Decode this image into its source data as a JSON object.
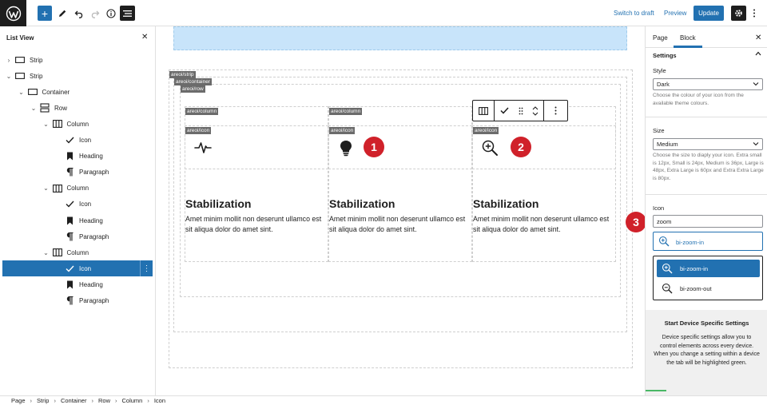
{
  "toolbar": {
    "add_label": "+",
    "switch_to_draft": "Switch to draft",
    "preview": "Preview",
    "update": "Update"
  },
  "list_view": {
    "title": "List View",
    "close": "✕",
    "items": [
      {
        "label": "Strip",
        "depth": 0,
        "chevron": "›",
        "icon": "strip-icon"
      },
      {
        "label": "Strip",
        "depth": 0,
        "chevron": "⌄",
        "icon": "strip-icon"
      },
      {
        "label": "Container",
        "depth": 1,
        "chevron": "⌄",
        "icon": "container-icon"
      },
      {
        "label": "Row",
        "depth": 2,
        "chevron": "⌄",
        "icon": "row-icon"
      },
      {
        "label": "Column",
        "depth": 3,
        "chevron": "⌄",
        "icon": "column-icon"
      },
      {
        "label": "Icon",
        "depth": 4,
        "chevron": "",
        "icon": "check-icon"
      },
      {
        "label": "Heading",
        "depth": 4,
        "chevron": "",
        "icon": "bookmark-icon"
      },
      {
        "label": "Paragraph",
        "depth": 4,
        "chevron": "",
        "icon": "pilcrow-icon"
      },
      {
        "label": "Column",
        "depth": 3,
        "chevron": "⌄",
        "icon": "column-icon"
      },
      {
        "label": "Icon",
        "depth": 4,
        "chevron": "",
        "icon": "check-icon"
      },
      {
        "label": "Heading",
        "depth": 4,
        "chevron": "",
        "icon": "bookmark-icon"
      },
      {
        "label": "Paragraph",
        "depth": 4,
        "chevron": "",
        "icon": "pilcrow-icon"
      },
      {
        "label": "Column",
        "depth": 3,
        "chevron": "⌄",
        "icon": "column-icon"
      },
      {
        "label": "Icon",
        "depth": 4,
        "chevron": "",
        "icon": "check-icon",
        "selected": true
      },
      {
        "label": "Heading",
        "depth": 4,
        "chevron": "",
        "icon": "bookmark-icon"
      },
      {
        "label": "Paragraph",
        "depth": 4,
        "chevron": "",
        "icon": "pilcrow-icon"
      }
    ],
    "row_options": "⋮"
  },
  "canvas": {
    "tags": {
      "strip": "areoi/strip",
      "container": "areoi/container",
      "row": "areoi/row",
      "column": "areoi/column",
      "icon": "areoi/icon"
    },
    "columns": [
      {
        "heading": "Stabilization",
        "paragraph": "Amet minim mollit non deserunt ullamco est sit aliqua dolor do amet sint.",
        "icon": "activity-icon"
      },
      {
        "heading": "Stabilization",
        "paragraph": "Amet minim mollit non deserunt ullamco est sit aliqua dolor do amet sint.",
        "icon": "lightbulb-icon"
      },
      {
        "heading": "Stabilization",
        "paragraph": "Amet minim mollit non deserunt ullamco est sit aliqua dolor do amet sint.",
        "icon": "zoom-in-icon"
      }
    ],
    "badges": [
      "1",
      "2",
      "3"
    ]
  },
  "panel": {
    "tab_page": "Page",
    "tab_block": "Block",
    "close": "✕",
    "section_title": "Settings",
    "style_label": "Style",
    "style_value": "Dark",
    "style_help": "Choose the colour of your icon from the available theme colours.",
    "size_label": "Size",
    "size_value": "Medium",
    "size_help": "Choose the size to diaply your icon. Extra small is 12px, Small is 24px, Medium is 36px, Large is 48px, Extra Large is 60px and Extra Extra Large is 80px.",
    "icon_label": "Icon",
    "icon_search_value": "zoom",
    "selected_icon": "bi-zoom-in",
    "options": [
      "bi-zoom-in",
      "bi-zoom-out"
    ],
    "device_title": "Start Device Specific Settings",
    "device_text": "Device specific settings allow you to control elements across every device. When you change a setting within a device the tab will be highlighted green."
  },
  "breadcrumb": [
    "Page",
    "Strip",
    "Container",
    "Row",
    "Column",
    "Icon"
  ],
  "colors": {
    "accent": "#2271b1",
    "badge": "#d0212a",
    "strip_bg": "#c8e4fa",
    "success": "#4ab866"
  }
}
